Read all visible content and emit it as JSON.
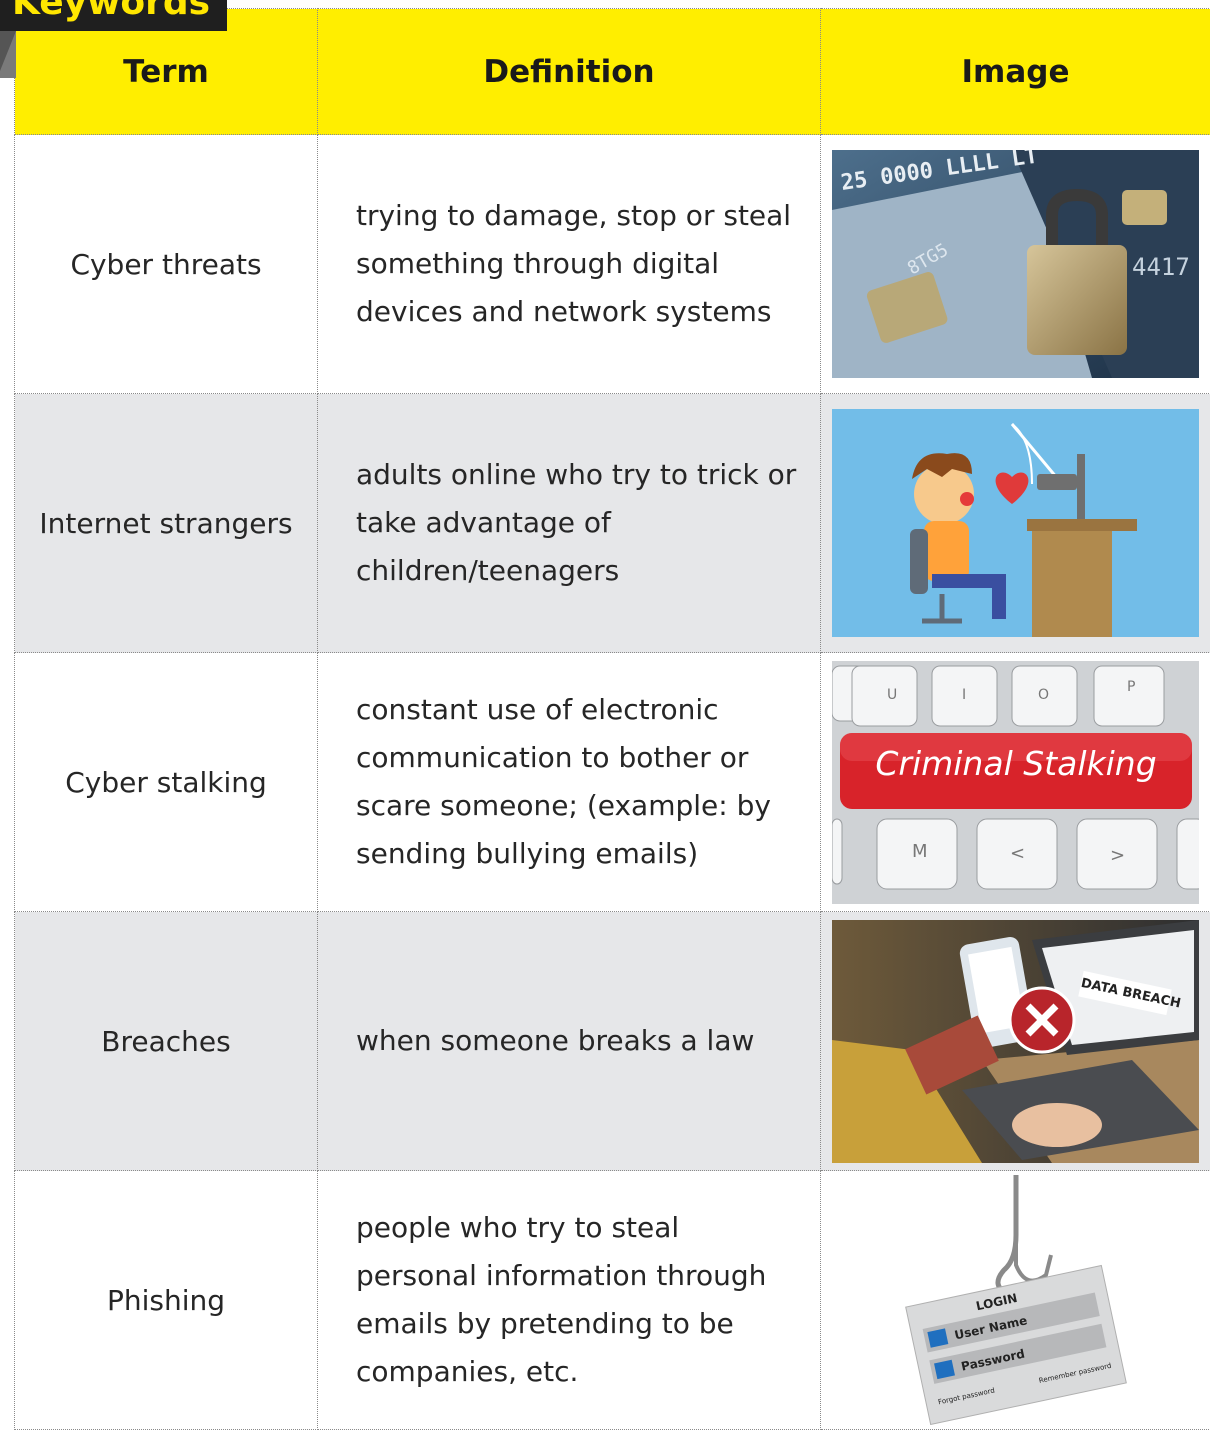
{
  "title": "Keywords",
  "headers": {
    "term": "Term",
    "definition": "Definition",
    "image": "Image"
  },
  "rows": [
    {
      "term": "Cyber threats",
      "definition": "trying to damage, stop or steal something through digital devices and network systems",
      "image": "padlock-on-credit-cards-image"
    },
    {
      "term": "Internet strangers",
      "definition": "adults online who try to trick or take advantage of children/teenagers",
      "image": "boy-at-computer-fishing-heart-image"
    },
    {
      "term": "Cyber stalking",
      "definition": "constant use of electronic communication to bother or scare someone; (example: by sending bullying emails)",
      "image": "criminal-stalking-keyboard-image"
    },
    {
      "term": "Breaches",
      "definition": "when someone breaks a law",
      "image": "data-breach-laptop-image"
    },
    {
      "term": "Phishing",
      "definition": "people who try to steal personal information through emails by pretending to be companies, etc.",
      "image": "login-card-on-fishhook-image"
    }
  ],
  "image_text": {
    "card_numbers_top": "25 0000 LLLL LT",
    "card_numbers_left": "8TG5",
    "card_side": "4417",
    "keyboard_label": "Criminal Stalking",
    "keys_top": [
      "U",
      "I",
      "O",
      "P"
    ],
    "keys_bottom": [
      "M",
      "<",
      ">"
    ],
    "breach_label": "DATA BREACH",
    "login_title": "LOGIN",
    "login_user": "User Name",
    "login_password": "Password",
    "login_forgot": "Forgot password",
    "login_remember": "Remember password"
  },
  "colors": {
    "header_yellow": "#ffee00",
    "alt_row_gray": "#e6e7e9",
    "ribbon_dark": "#1f1f1f",
    "ribbon_text": "#ffe600",
    "keyboard_red": "#d8232a",
    "stranger_sky": "#72bde8"
  }
}
